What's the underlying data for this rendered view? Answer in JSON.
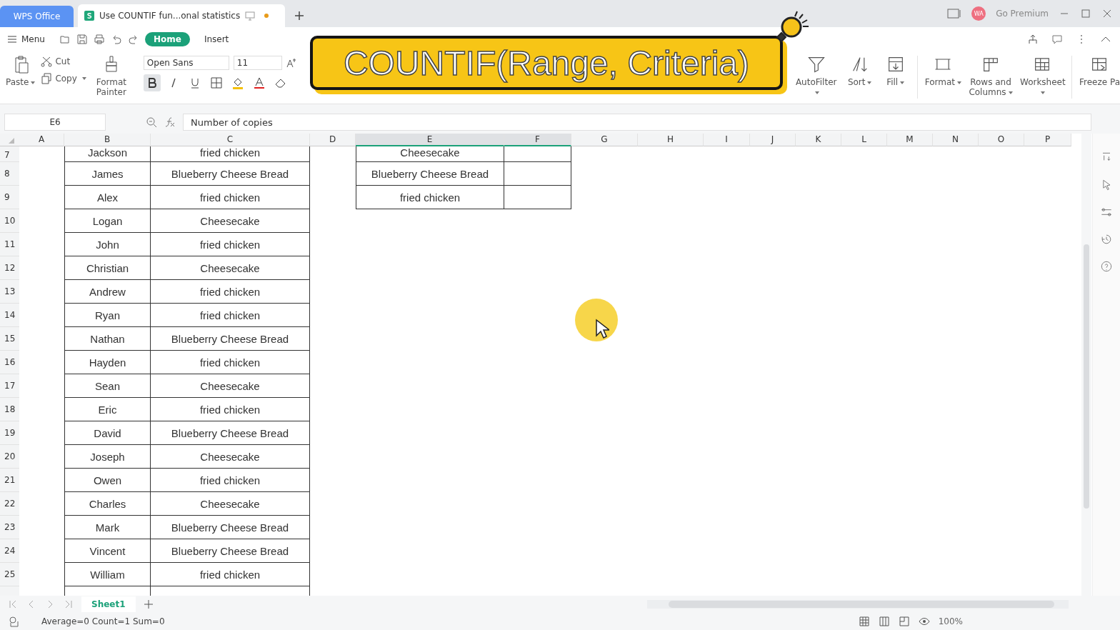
{
  "title_bar": {
    "app_tab": "WPS Office",
    "doc_tab": {
      "title": "Use COUNTIF fun...onal statistics",
      "unsaved": true
    },
    "account": "WA",
    "premium": "Go Premium"
  },
  "menu_bar": {
    "menu": "Menu",
    "tabs": [
      {
        "label": "Home",
        "selected": true
      },
      {
        "label": "Insert",
        "selected": false
      }
    ]
  },
  "ribbon": {
    "paste": "Paste",
    "cut": "Cut",
    "copy": "Copy",
    "format_painter": "Format Painter",
    "font": "Open Sans",
    "size": "11",
    "bold": true,
    "tools": [
      {
        "label": "AutoFilter",
        "dropdown": true
      },
      {
        "label": "Sort",
        "dropdown": true
      },
      {
        "label": "Fill",
        "dropdown": true
      },
      {
        "label": "Format",
        "dropdown": true
      },
      {
        "label": "Rows and Columns",
        "dropdown": true
      },
      {
        "label": "Worksheet",
        "dropdown": true
      },
      {
        "label": "Freeze Pa",
        "dropdown": false
      }
    ]
  },
  "banner": {
    "text": "COUNTIF(Range, Criteria)"
  },
  "formula_bar": {
    "name_box": "E6",
    "formula": "Number of copies"
  },
  "columns": [
    {
      "label": "A",
      "selected": false
    },
    {
      "label": "B",
      "selected": false
    },
    {
      "label": "C",
      "selected": false
    },
    {
      "label": "D",
      "selected": false
    },
    {
      "label": "E",
      "selected": true
    },
    {
      "label": "F",
      "selected": true
    },
    {
      "label": "G",
      "selected": false
    },
    {
      "label": "H",
      "selected": false
    },
    {
      "label": "I",
      "selected": false
    },
    {
      "label": "J",
      "selected": false
    },
    {
      "label": "K",
      "selected": false
    },
    {
      "label": "L",
      "selected": false
    },
    {
      "label": "M",
      "selected": false
    },
    {
      "label": "N",
      "selected": false
    },
    {
      "label": "O",
      "selected": false
    },
    {
      "label": "P",
      "selected": false
    }
  ],
  "rows": [
    {
      "number": "7",
      "name": "Jackson",
      "food": "fried chicken",
      "criteria": "Cheesecake"
    },
    {
      "number": "8",
      "name": "James",
      "food": "Blueberry Cheese Bread",
      "criteria": "Blueberry Cheese Bread"
    },
    {
      "number": "9",
      "name": "Alex",
      "food": "fried chicken",
      "criteria": "fried chicken"
    },
    {
      "number": "10",
      "name": "Logan",
      "food": "Cheesecake"
    },
    {
      "number": "11",
      "name": "John",
      "food": "fried chicken"
    },
    {
      "number": "12",
      "name": "Christian",
      "food": "Cheesecake"
    },
    {
      "number": "13",
      "name": "Andrew",
      "food": "fried chicken"
    },
    {
      "number": "14",
      "name": "Ryan",
      "food": "fried chicken"
    },
    {
      "number": "15",
      "name": "Nathan",
      "food": "Blueberry Cheese Bread"
    },
    {
      "number": "16",
      "name": "Hayden",
      "food": "fried chicken"
    },
    {
      "number": "17",
      "name": "Sean",
      "food": "Cheesecake"
    },
    {
      "number": "18",
      "name": "Eric",
      "food": "fried chicken"
    },
    {
      "number": "19",
      "name": "David",
      "food": "Blueberry Cheese Bread"
    },
    {
      "number": "20",
      "name": "Joseph",
      "food": "Cheesecake"
    },
    {
      "number": "21",
      "name": "Owen",
      "food": "fried chicken"
    },
    {
      "number": "22",
      "name": "Charles",
      "food": "Cheesecake"
    },
    {
      "number": "23",
      "name": "Mark",
      "food": "Blueberry Cheese Bread"
    },
    {
      "number": "24",
      "name": "Vincent",
      "food": "Blueberry Cheese Bread"
    },
    {
      "number": "25",
      "name": "William",
      "food": "fried chicken"
    }
  ],
  "sheet_tabs": [
    {
      "label": "Sheet1",
      "selected": true
    }
  ],
  "status_bar": {
    "summary": "Average=0 Count=1 Sum=0",
    "zoom": "100%"
  }
}
